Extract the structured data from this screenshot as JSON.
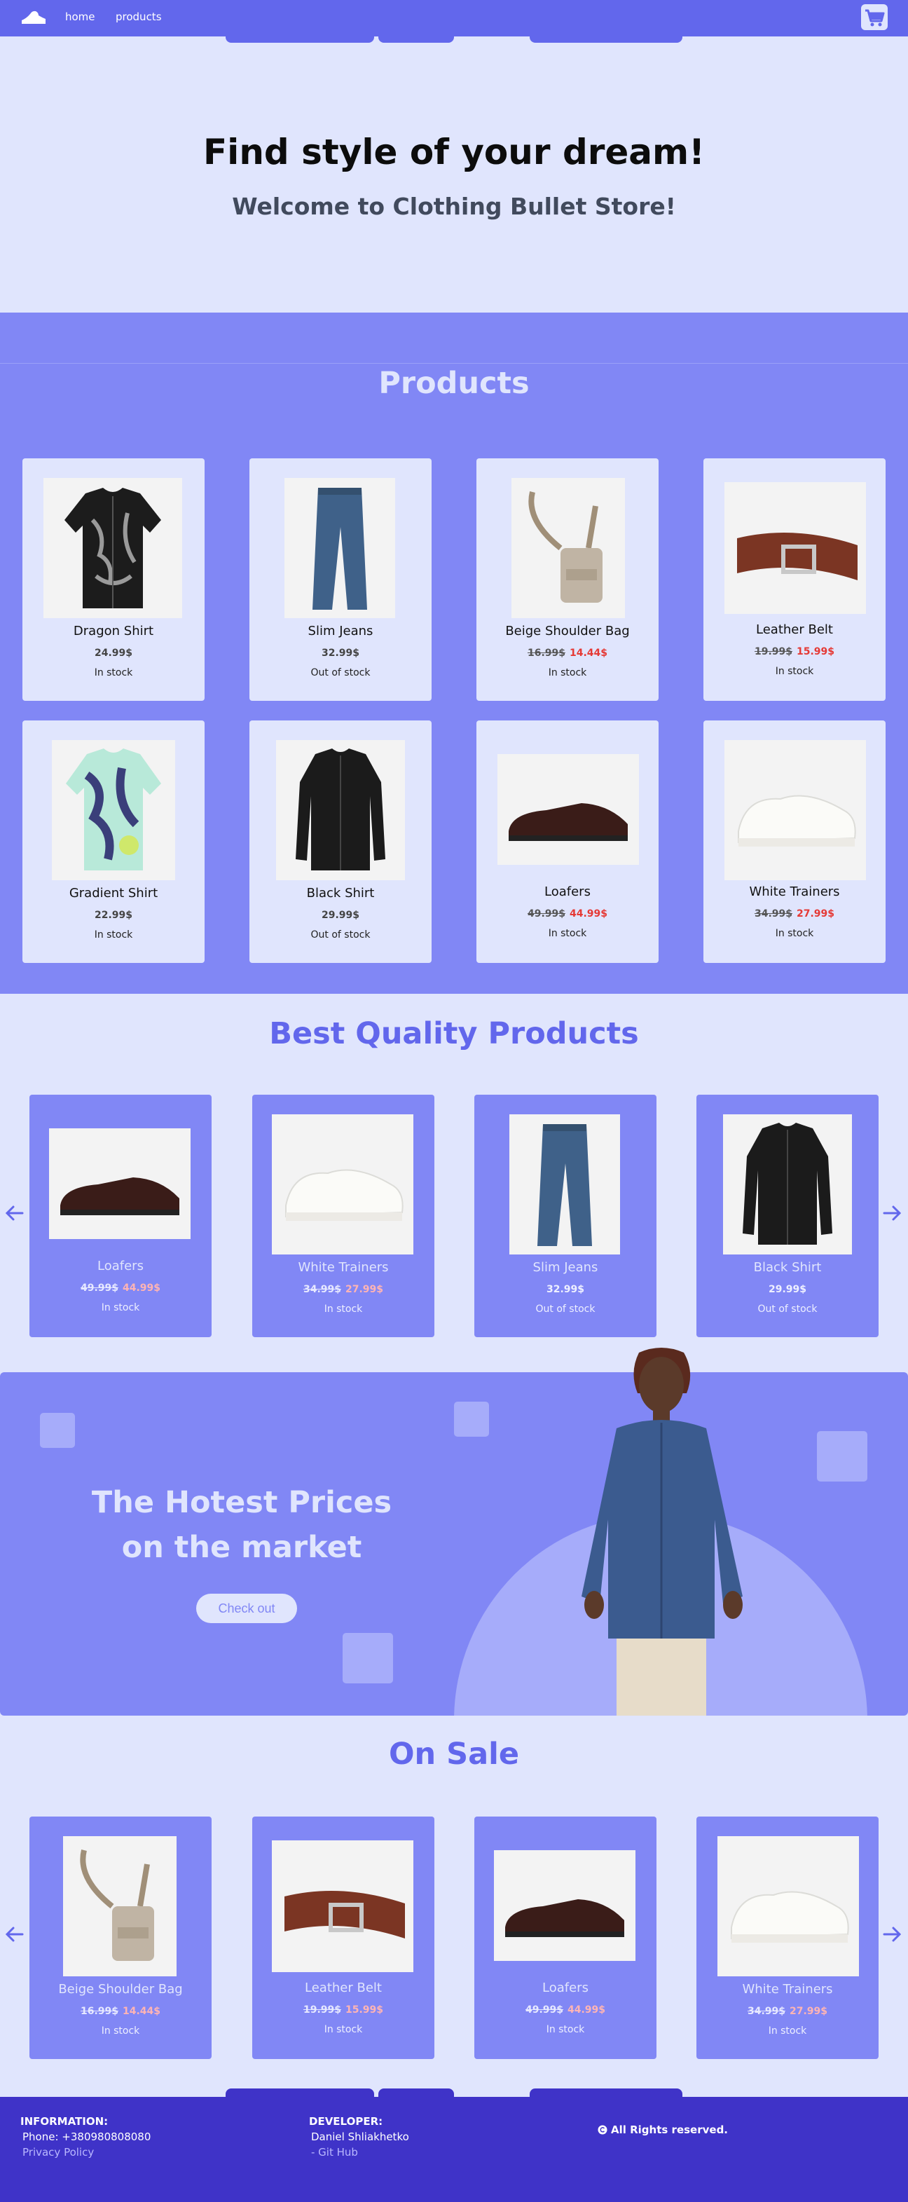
{
  "nav": {
    "home": "home",
    "products": "products"
  },
  "hero": {
    "title": "Find style of your dream!",
    "subtitle": "Welcome to Clothing Bullet Store!"
  },
  "products": {
    "title": "Products",
    "items": [
      {
        "name": "Dragon Shirt",
        "price": "24.99$",
        "old": "",
        "stock": "In stock"
      },
      {
        "name": "Slim Jeans",
        "price": "32.99$",
        "old": "",
        "stock": "Out of stock"
      },
      {
        "name": "Beige Shoulder Bag",
        "price": "14.44$",
        "old": "16.99$",
        "stock": "In stock"
      },
      {
        "name": "Leather Belt",
        "price": "15.99$",
        "old": "19.99$",
        "stock": "In stock"
      },
      {
        "name": "Gradient Shirt",
        "price": "22.99$",
        "old": "",
        "stock": "In stock"
      },
      {
        "name": "Black Shirt",
        "price": "29.99$",
        "old": "",
        "stock": "Out of stock"
      },
      {
        "name": "Loafers",
        "price": "44.99$",
        "old": "49.99$",
        "stock": "In stock"
      },
      {
        "name": "White Trainers",
        "price": "27.99$",
        "old": "34.99$",
        "stock": "In stock"
      }
    ]
  },
  "best": {
    "title": "Best Quality Products",
    "items": [
      {
        "name": "Loafers",
        "price": "44.99$",
        "old": "49.99$",
        "stock": "In stock"
      },
      {
        "name": "White Trainers",
        "price": "27.99$",
        "old": "34.99$",
        "stock": "In stock"
      },
      {
        "name": "Slim Jeans",
        "price": "32.99$",
        "old": "",
        "stock": "Out of stock"
      },
      {
        "name": "Black Shirt",
        "price": "29.99$",
        "old": "",
        "stock": "Out of stock"
      }
    ]
  },
  "banner": {
    "line1": "The Hotest Prices",
    "line2": "on the market",
    "button": "Check out"
  },
  "sale": {
    "title": "On Sale",
    "items": [
      {
        "name": "Beige Shoulder Bag",
        "price": "14.44$",
        "old": "16.99$",
        "stock": "In stock"
      },
      {
        "name": "Leather Belt",
        "price": "15.99$",
        "old": "19.99$",
        "stock": "In stock"
      },
      {
        "name": "Loafers",
        "price": "44.99$",
        "old": "49.99$",
        "stock": "In stock"
      },
      {
        "name": "White Trainers",
        "price": "27.99$",
        "old": "34.99$",
        "stock": "In stock"
      }
    ]
  },
  "footer": {
    "info_heading": "INFORMATION:",
    "phone": "Phone: +380980808080",
    "privacy": "Privacy Policy",
    "dev_heading": "DEVELOPER:",
    "dev_name": "Daniel Shliakhetko",
    "github": "- Git Hub",
    "copyright": "All Rights reserved."
  },
  "colors": {
    "accent": "#6267ec",
    "section": "#8187f5",
    "background": "#e0e5fd",
    "footer": "#3f33c8",
    "sale_price": "#e53935"
  }
}
